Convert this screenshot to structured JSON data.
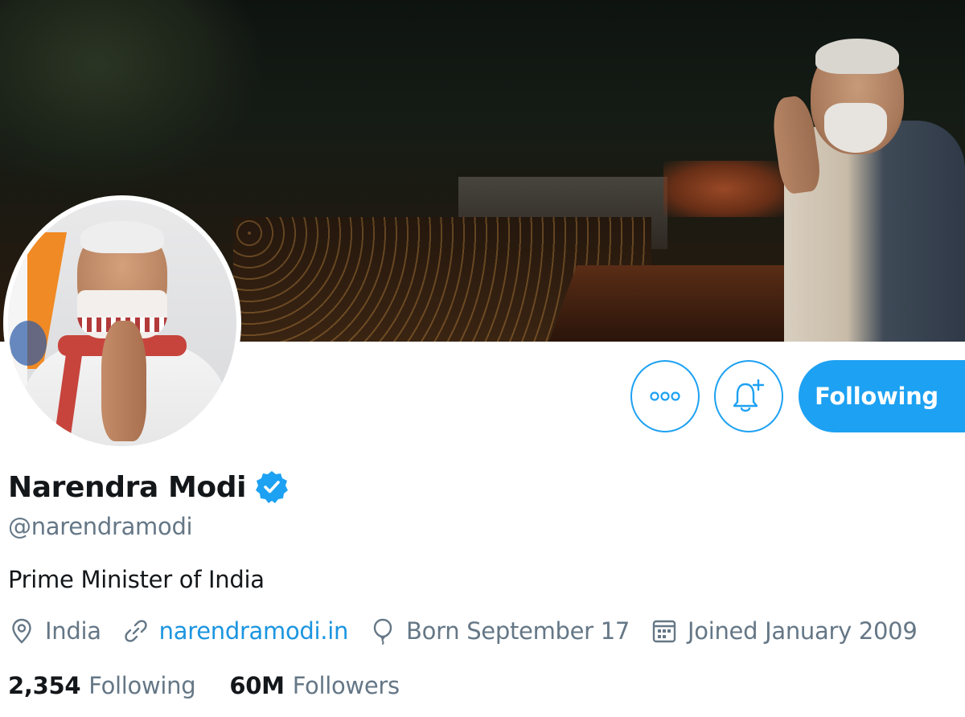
{
  "profile": {
    "display_name": "Narendra Modi",
    "handle": "@narendramodi",
    "bio": "Prime Minister of India",
    "verified": true,
    "location": "India",
    "website": "narendramodi.in",
    "birthday": "Born September 17",
    "joined": "Joined January 2009"
  },
  "stats": {
    "following_count": "2,354",
    "following_label": "Following",
    "followers_count": "60M",
    "followers_label": "Followers"
  },
  "actions": {
    "follow_label": "Following",
    "more_icon": "more-horizontal-icon",
    "notify_icon": "bell-plus-icon"
  },
  "colors": {
    "accent": "#1da1f2",
    "link": "#1b95e0",
    "secondary_text": "#657786",
    "primary_text": "#14171a"
  },
  "icons": {
    "location": "map-pin-icon",
    "website": "link-icon",
    "birthday": "balloon-icon",
    "joined": "calendar-icon",
    "verified": "verified-badge-icon"
  }
}
